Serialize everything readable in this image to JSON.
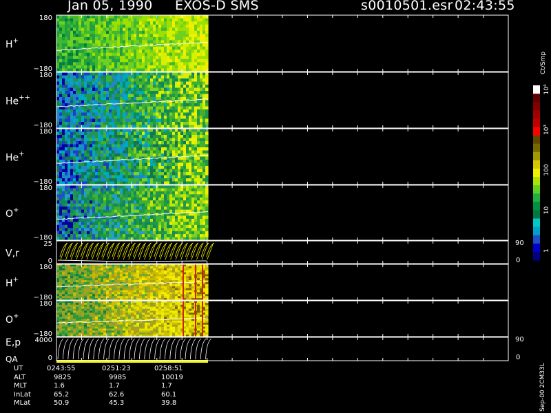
{
  "header": {
    "date": "Jan 05, 1990",
    "instrument": "EXOS-D SMS",
    "file": "s0010501.esr",
    "time": "02:43:55"
  },
  "panels": [
    {
      "label": "H",
      "sup": "+",
      "top_tick": "180",
      "bottom_tick": "−180",
      "style": "spectro",
      "palette": "h"
    },
    {
      "label": "He",
      "sup": "++",
      "top_tick": "180",
      "bottom_tick": "−180",
      "style": "spectro",
      "palette": "hepp"
    },
    {
      "label": "He",
      "sup": "+",
      "top_tick": "180",
      "bottom_tick": "−180",
      "style": "spectro",
      "palette": "hep"
    },
    {
      "label": "O",
      "sup": "+",
      "top_tick": "180",
      "bottom_tick": "−180",
      "style": "spectro",
      "palette": "op"
    },
    {
      "label": "V,r",
      "sup": "",
      "top_tick": "25",
      "bottom_tick": "0",
      "style": "vector",
      "right_top": "90",
      "right_bottom": "0"
    },
    {
      "label": "H",
      "sup": "+",
      "top_tick": "180",
      "bottom_tick": "−180",
      "style": "spectro",
      "palette": "h2"
    },
    {
      "label": "O",
      "sup": "+",
      "top_tick": "180",
      "bottom_tick": "−180",
      "style": "spectro",
      "palette": "o2"
    },
    {
      "label": "E,p",
      "sup": "",
      "label2": "QA",
      "top_tick": "4000",
      "bottom_tick": "0",
      "style": "energy",
      "right_top": "90",
      "right_bottom": "0"
    }
  ],
  "colorbar": {
    "unit_label": "Ct/Smp",
    "ticks": [
      "1",
      "10",
      "100",
      "10³",
      "10⁴"
    ],
    "colors": [
      "#000080",
      "#0000cd",
      "#1e50c8",
      "#00a0c8",
      "#00c8c8",
      "#007840",
      "#009040",
      "#20b040",
      "#60d020",
      "#b0e000",
      "#f0f000",
      "#d8c800",
      "#a09800",
      "#786800",
      "#604800",
      "#ff0000",
      "#c00000",
      "#a00000",
      "#800000",
      "#600000",
      "#ffffff"
    ]
  },
  "footer": {
    "rows": [
      {
        "label": "UT",
        "values": [
          "0243:55",
          "0251:23",
          "0258:51"
        ]
      },
      {
        "label": "ALT",
        "values": [
          "9825",
          "9985",
          "10019"
        ]
      },
      {
        "label": "MLT",
        "values": [
          "1.6",
          "1.7",
          "1.7"
        ]
      },
      {
        "label": "InLat",
        "values": [
          "65.2",
          "62.6",
          "60.1"
        ]
      },
      {
        "label": "MLat",
        "values": [
          "50.9",
          "45.3",
          "39.8"
        ]
      }
    ],
    "version": "Sep-00 2CM33L"
  },
  "chart_data": {
    "type": "heatmap",
    "title": "Jan 05, 1990   EXOS-D SMS",
    "x_ticks_UT": [
      "0243:55",
      "0251:23",
      "0258:51"
    ],
    "data_fraction_of_time_axis": 0.32,
    "colorbar_scale": "log",
    "colorbar_range": [
      1,
      10000
    ],
    "colorbar_unit": "Ct/Smp"
  }
}
